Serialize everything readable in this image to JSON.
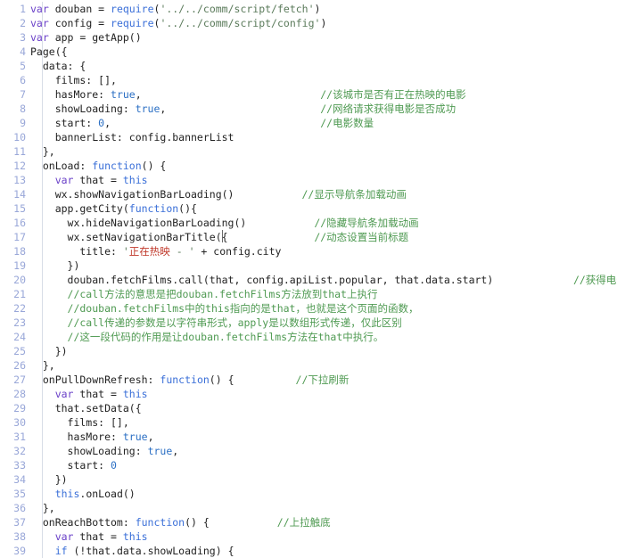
{
  "editor": {
    "name": "code-editor",
    "language": "javascript",
    "background_color": "#ffffff",
    "gutter_color": "#99a7d8",
    "total_lines_visible": 39,
    "first_line": 1,
    "last_line": 39,
    "caret": {
      "line": 17,
      "after_text": "wx.setNavigationBarTitle("
    }
  },
  "colors": {
    "keyword": "#6a40c8",
    "function": "#3a6fd8",
    "string": "#5a7a5a",
    "string_cn": "#c0392b",
    "comment": "#4f9a52",
    "number": "#2b6fc4",
    "plain": "#222222",
    "line_number": "#99a7d8",
    "indent_guide": "#d8dde6"
  },
  "lines": [
    {
      "n": "1",
      "indent": 0,
      "tokens": [
        {
          "t": "var",
          "c": "kw"
        },
        {
          "t": " douban = ",
          "c": "plain"
        },
        {
          "t": "require",
          "c": "fn"
        },
        {
          "t": "(",
          "c": "plain"
        },
        {
          "t": "'../../comm/script/fetch'",
          "c": "str"
        },
        {
          "t": ")",
          "c": "plain"
        }
      ]
    },
    {
      "n": "2",
      "indent": 0,
      "tokens": [
        {
          "t": "var",
          "c": "kw"
        },
        {
          "t": " config = ",
          "c": "plain"
        },
        {
          "t": "require",
          "c": "fn"
        },
        {
          "t": "(",
          "c": "plain"
        },
        {
          "t": "'../../comm/script/config'",
          "c": "str"
        },
        {
          "t": ")",
          "c": "plain"
        }
      ]
    },
    {
      "n": "3",
      "indent": 0,
      "tokens": [
        {
          "t": "var",
          "c": "kw"
        },
        {
          "t": " app = getApp()",
          "c": "plain"
        }
      ]
    },
    {
      "n": "4",
      "indent": 0,
      "tokens": [
        {
          "t": "Page({",
          "c": "plain"
        }
      ]
    },
    {
      "n": "5",
      "indent": 1,
      "tokens": [
        {
          "t": "  data: {",
          "c": "plain"
        }
      ]
    },
    {
      "n": "6",
      "indent": 2,
      "tokens": [
        {
          "t": "    films: [],",
          "c": "plain"
        }
      ]
    },
    {
      "n": "7",
      "indent": 2,
      "tokens": [
        {
          "t": "    hasMore: ",
          "c": "plain"
        },
        {
          "t": "true",
          "c": "bool"
        },
        {
          "t": ",",
          "c": "plain"
        }
      ],
      "comment": "//该城市是否有正在热映的电影",
      "comment_col": 47
    },
    {
      "n": "8",
      "indent": 2,
      "tokens": [
        {
          "t": "    showLoading: ",
          "c": "plain"
        },
        {
          "t": "true",
          "c": "bool"
        },
        {
          "t": ",",
          "c": "plain"
        }
      ],
      "comment": "//网络请求获得电影是否成功",
      "comment_col": 47
    },
    {
      "n": "9",
      "indent": 2,
      "tokens": [
        {
          "t": "    start: ",
          "c": "plain"
        },
        {
          "t": "0",
          "c": "num"
        },
        {
          "t": ",",
          "c": "plain"
        }
      ],
      "comment": "//电影数量",
      "comment_col": 47
    },
    {
      "n": "10",
      "indent": 2,
      "tokens": [
        {
          "t": "    bannerList: config.bannerList",
          "c": "plain"
        }
      ]
    },
    {
      "n": "11",
      "indent": 1,
      "tokens": [
        {
          "t": "  },",
          "c": "plain"
        }
      ]
    },
    {
      "n": "12",
      "indent": 1,
      "tokens": [
        {
          "t": "  onLoad: ",
          "c": "plain"
        },
        {
          "t": "function",
          "c": "fn"
        },
        {
          "t": "() {",
          "c": "plain"
        }
      ]
    },
    {
      "n": "13",
      "indent": 2,
      "tokens": [
        {
          "t": "    ",
          "c": "plain"
        },
        {
          "t": "var",
          "c": "kw"
        },
        {
          "t": " that = ",
          "c": "plain"
        },
        {
          "t": "this",
          "c": "fn"
        }
      ]
    },
    {
      "n": "14",
      "indent": 2,
      "tokens": [
        {
          "t": "    wx.showNavigationBarLoading()",
          "c": "plain"
        }
      ],
      "comment": "//显示导航条加载动画",
      "comment_col": 44
    },
    {
      "n": "15",
      "indent": 2,
      "tokens": [
        {
          "t": "    app.getCity(",
          "c": "plain"
        },
        {
          "t": "function",
          "c": "fn"
        },
        {
          "t": "(){",
          "c": "plain"
        }
      ]
    },
    {
      "n": "16",
      "indent": 3,
      "tokens": [
        {
          "t": "      wx.hideNavigationBarLoading()",
          "c": "plain"
        }
      ],
      "comment": "//隐藏导航条加载动画",
      "comment_col": 46
    },
    {
      "n": "17",
      "indent": 3,
      "tokens": [
        {
          "t": "      wx.setNavigationBarTitle({",
          "c": "plain"
        }
      ],
      "comment": "//动态设置当前标题",
      "comment_col": 46
    },
    {
      "n": "18",
      "indent": 4,
      "tokens": [
        {
          "t": "        title: ",
          "c": "plain"
        },
        {
          "t": "'",
          "c": "str"
        },
        {
          "t": "正在热映",
          "c": "strcn"
        },
        {
          "t": " - '",
          "c": "str"
        },
        {
          "t": " + config.city",
          "c": "plain"
        }
      ]
    },
    {
      "n": "19",
      "indent": 3,
      "tokens": [
        {
          "t": "      })",
          "c": "plain"
        }
      ]
    },
    {
      "n": "20",
      "indent": 3,
      "tokens": [
        {
          "t": "      douban.fetchFilms.call(that, config.apiList.popular, that.data.start)",
          "c": "plain"
        }
      ],
      "comment": "//获得电影列表",
      "comment_col": 88
    },
    {
      "n": "21",
      "indent": 3,
      "tokens": [
        {
          "t": "      //call方法的意思是把douban.fetchFilms方法放到that上执行",
          "c": "cmt"
        }
      ]
    },
    {
      "n": "22",
      "indent": 3,
      "tokens": [
        {
          "t": "      //douban.fetchFilms中的this指向的是that，也就是这个页面的函数，",
          "c": "cmt"
        }
      ]
    },
    {
      "n": "23",
      "indent": 3,
      "tokens": [
        {
          "t": "      //call传递的参数是以字符串形式，apply是以数组形式传递，仅此区别",
          "c": "cmt"
        }
      ]
    },
    {
      "n": "24",
      "indent": 3,
      "tokens": [
        {
          "t": "      //这一段代码的作用是让douban.fetchFilms方法在that中执行。",
          "c": "cmt"
        }
      ]
    },
    {
      "n": "25",
      "indent": 2,
      "tokens": [
        {
          "t": "    })",
          "c": "plain"
        }
      ]
    },
    {
      "n": "26",
      "indent": 1,
      "tokens": [
        {
          "t": "  },",
          "c": "plain"
        }
      ]
    },
    {
      "n": "27",
      "indent": 1,
      "tokens": [
        {
          "t": "  onPullDownRefresh: ",
          "c": "plain"
        },
        {
          "t": "function",
          "c": "fn"
        },
        {
          "t": "() {",
          "c": "plain"
        }
      ],
      "comment": "//下拉刷新",
      "comment_col": 43
    },
    {
      "n": "28",
      "indent": 2,
      "tokens": [
        {
          "t": "    ",
          "c": "plain"
        },
        {
          "t": "var",
          "c": "kw"
        },
        {
          "t": " that = ",
          "c": "plain"
        },
        {
          "t": "this",
          "c": "fn"
        }
      ]
    },
    {
      "n": "29",
      "indent": 2,
      "tokens": [
        {
          "t": "    that.setData({",
          "c": "plain"
        }
      ]
    },
    {
      "n": "30",
      "indent": 3,
      "tokens": [
        {
          "t": "      films: [],",
          "c": "plain"
        }
      ]
    },
    {
      "n": "31",
      "indent": 3,
      "tokens": [
        {
          "t": "      hasMore: ",
          "c": "plain"
        },
        {
          "t": "true",
          "c": "bool"
        },
        {
          "t": ",",
          "c": "plain"
        }
      ]
    },
    {
      "n": "32",
      "indent": 3,
      "tokens": [
        {
          "t": "      showLoading: ",
          "c": "plain"
        },
        {
          "t": "true",
          "c": "bool"
        },
        {
          "t": ",",
          "c": "plain"
        }
      ]
    },
    {
      "n": "33",
      "indent": 3,
      "tokens": [
        {
          "t": "      start: ",
          "c": "plain"
        },
        {
          "t": "0",
          "c": "num"
        }
      ]
    },
    {
      "n": "34",
      "indent": 2,
      "tokens": [
        {
          "t": "    })",
          "c": "plain"
        }
      ]
    },
    {
      "n": "35",
      "indent": 2,
      "tokens": [
        {
          "t": "    ",
          "c": "plain"
        },
        {
          "t": "this",
          "c": "fn"
        },
        {
          "t": ".onLoad()",
          "c": "plain"
        }
      ]
    },
    {
      "n": "36",
      "indent": 1,
      "tokens": [
        {
          "t": "  },",
          "c": "plain"
        }
      ]
    },
    {
      "n": "37",
      "indent": 1,
      "tokens": [
        {
          "t": "  onReachBottom: ",
          "c": "plain"
        },
        {
          "t": "function",
          "c": "fn"
        },
        {
          "t": "() {",
          "c": "plain"
        }
      ],
      "comment": "//上拉触底",
      "comment_col": 40
    },
    {
      "n": "38",
      "indent": 2,
      "tokens": [
        {
          "t": "    ",
          "c": "plain"
        },
        {
          "t": "var",
          "c": "kw"
        },
        {
          "t": " that = ",
          "c": "plain"
        },
        {
          "t": "this",
          "c": "fn"
        }
      ]
    },
    {
      "n": "39",
      "indent": 2,
      "tokens": [
        {
          "t": "    ",
          "c": "plain"
        },
        {
          "t": "if",
          "c": "fn"
        },
        {
          "t": " (!that.data.showLoading) {",
          "c": "plain"
        }
      ]
    }
  ]
}
